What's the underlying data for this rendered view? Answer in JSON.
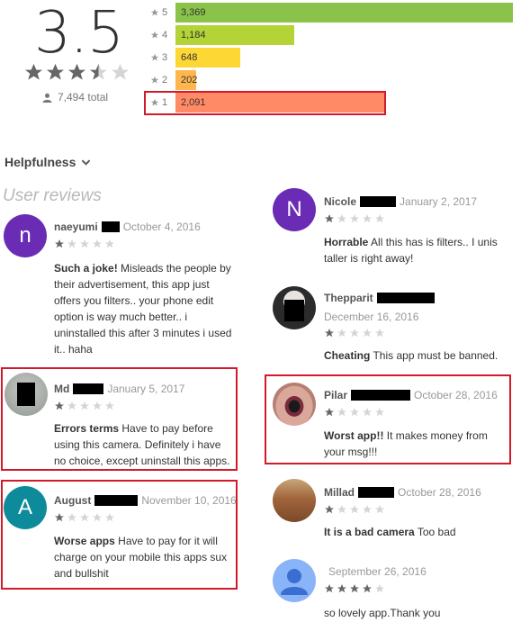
{
  "summary": {
    "score": "3.5",
    "score_stars": 3.5,
    "total": "7,494 total"
  },
  "histogram": [
    {
      "star": "5",
      "count": "3,369",
      "fraction": 1.0,
      "color": "#8bc34a"
    },
    {
      "star": "4",
      "count": "1,184",
      "fraction": 0.351,
      "color": "#b4d337"
    },
    {
      "star": "3",
      "count": "648",
      "fraction": 0.192,
      "color": "#fdd835"
    },
    {
      "star": "2",
      "count": "202",
      "fraction": 0.06,
      "color": "#ffb74d"
    },
    {
      "star": "1",
      "count": "2,091",
      "fraction": 0.62,
      "color": "#ff8a65"
    }
  ],
  "helpfulness_label": "Helpfulness",
  "user_reviews_label": "User reviews",
  "reviews": {
    "naeyumi": {
      "initial": "n",
      "name": "naeyumi",
      "date": "October 4, 2016",
      "rating": 1,
      "title": "Such a joke!",
      "body": "Misleads the people by their advertisement, this app just offers you filters.. your phone edit option is way much better.. i uninstalled this after 3 minutes i used it.. haha"
    },
    "md": {
      "name": "Md",
      "date": "January 5, 2017",
      "rating": 1,
      "title": "Errors terms",
      "body": "Have to pay before using this camera. Definitely i have no choice, except uninstall this apps."
    },
    "august": {
      "initial": "A",
      "name": "August",
      "date": "November 10, 2016",
      "rating": 1,
      "title": "Worse apps",
      "body": "Have to pay for it will charge on your mobile this apps sux and bullshit"
    },
    "nicole": {
      "initial": "N",
      "name": "Nicole",
      "date": "January 2, 2017",
      "rating": 1,
      "title": "Horrable",
      "body": "All this has is filters.. I unis taller is right away!"
    },
    "thepparit": {
      "name": "Thepparit",
      "date": "December 16, 2016",
      "rating": 1,
      "title": "Cheating",
      "body": "This app must be banned."
    },
    "pilar": {
      "name": "Pilar",
      "date": "October 28, 2016",
      "rating": 1,
      "title": "Worst app!!",
      "body": "It makes money from your msg!!!"
    },
    "millad": {
      "name": "Millad",
      "date": "October 28, 2016",
      "rating": 1,
      "title": "It is a bad camera",
      "body": "Too bad"
    },
    "anon": {
      "name": "",
      "date": "September 26, 2016",
      "rating": 4,
      "title": "",
      "body": "so lovely app.Thank you"
    }
  },
  "colors": {
    "star_filled": "#666666",
    "star_empty": "#d5d5d5",
    "highlight": "#d11a2a",
    "avatar_purple": "#6a2bb5",
    "avatar_teal": "#0e8b9a",
    "avatar_blue": "#8ab4f8"
  }
}
